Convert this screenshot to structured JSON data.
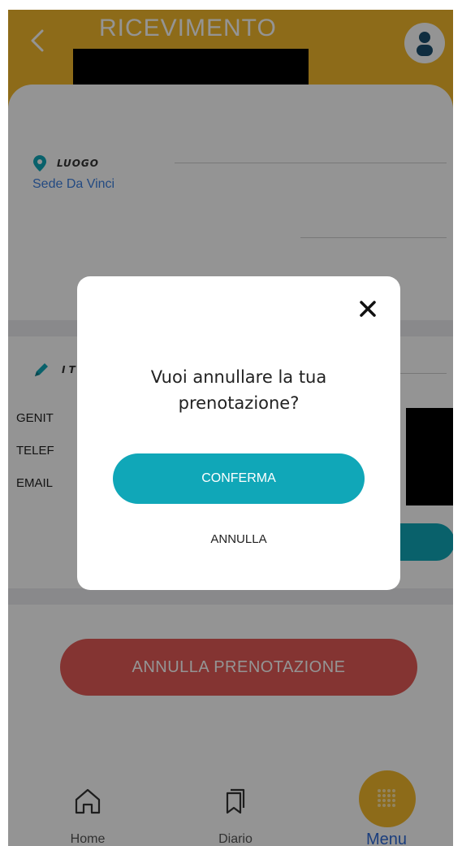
{
  "header": {
    "title": "RICEVIMENTO",
    "back_icon": "chevron-left-icon",
    "avatar_icon": "user-icon"
  },
  "colors": {
    "header": "#f3b92b",
    "accent_teal": "#10a7b8",
    "danger": "#e35b56",
    "link_blue": "#3d80e0"
  },
  "location": {
    "label": "LUOGO",
    "value": "Sede Da Vinci"
  },
  "info": {
    "label": "I T",
    "fields": [
      "GENIT",
      "TELEF",
      "EMAIL"
    ]
  },
  "actions": {
    "cancel_booking": "ANNULLA PRENOTAZIONE"
  },
  "dialog": {
    "message": "Vuoi annullare la tua prenotazione?",
    "confirm": "CONFERMA",
    "cancel": "ANNULLA"
  },
  "nav": {
    "home": "Home",
    "diario": "Diario",
    "menu": "Menu"
  }
}
